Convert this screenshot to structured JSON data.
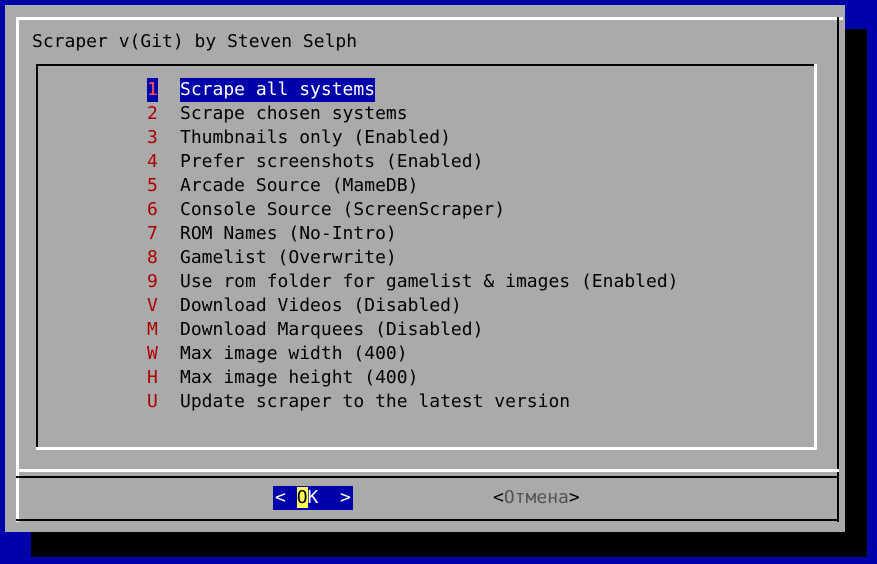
{
  "dialog": {
    "title": "Scraper v(Git) by Steven Selph"
  },
  "menu": {
    "items": [
      {
        "key": "1",
        "label": "Scrape all systems",
        "selected": true
      },
      {
        "key": "2",
        "label": "Scrape chosen systems"
      },
      {
        "key": "3",
        "label": "Thumbnails only (Enabled)"
      },
      {
        "key": "4",
        "label": "Prefer screenshots (Enabled)"
      },
      {
        "key": "5",
        "label": "Arcade Source (MameDB)"
      },
      {
        "key": "6",
        "label": "Console Source (ScreenScraper)"
      },
      {
        "key": "7",
        "label": "ROM Names (No-Intro)"
      },
      {
        "key": "8",
        "label": "Gamelist (Overwrite)"
      },
      {
        "key": "9",
        "label": "Use rom folder for gamelist & images (Enabled)"
      },
      {
        "key": "V",
        "label": "Download Videos (Disabled)"
      },
      {
        "key": "M",
        "label": "Download Marquees (Disabled)"
      },
      {
        "key": "W",
        "label": "Max image width (400)"
      },
      {
        "key": "H",
        "label": "Max image height (400)"
      },
      {
        "key": "U",
        "label": "Update scraper to the latest version"
      }
    ]
  },
  "buttons": {
    "ok": {
      "left": "< ",
      "hot": "O",
      "rest": "K  >"
    },
    "cancel": {
      "open": "<",
      "label": "Отмена",
      "close": ">"
    }
  },
  "colors": {
    "background": "#0000aa",
    "dialog": "#aaaaaa",
    "hotkey": "#aa0000",
    "selection": "#0000aa",
    "ok_hotkey_bg": "#ffff55"
  }
}
